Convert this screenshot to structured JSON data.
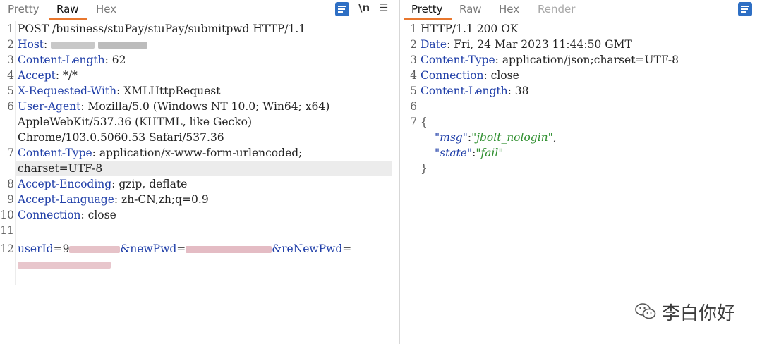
{
  "request": {
    "tabs": [
      {
        "label": "Pretty",
        "state": "normal"
      },
      {
        "label": "Raw",
        "state": "active"
      },
      {
        "label": "Hex",
        "state": "normal"
      }
    ],
    "newline_label": "\\n",
    "menu_icon": "hamburger-icon",
    "wrap_icon": "word-wrap-icon",
    "lines": {
      "l1": "POST /business/stuPay/stuPay/submitpwd HTTP/1.1",
      "l2k": "Host",
      "l3k": "Content-Length",
      "l3v": ": 62",
      "l4k": "Accept",
      "l4v": ": */*",
      "l5k": "X-Requested-With",
      "l5v": ": XMLHttpRequest",
      "l6k": "User-Agent",
      "l6v": ": Mozilla/5.0 (Windows NT 10.0; Win64; x64)",
      "l6b": "AppleWebKit/537.36 (KHTML, like Gecko)",
      "l6c": "Chrome/103.0.5060.53 Safari/537.36",
      "l7k": "Content-Type",
      "l7v": ": application/x-www-form-urlencoded;",
      "l7b": "charset=UTF-8",
      "l8k": "Accept-Encoding",
      "l8v": ": gzip, deflate",
      "l9k": "Accept-Language",
      "l9v": ": zh-CN,zh;q=0.9",
      "l10k": "Connection",
      "l10v": ": close",
      "l12a": "userId",
      "l12b": "=9",
      "l12c": "&newPwd",
      "l12d": "=",
      "l12e": "&reNewPwd",
      "l12f": "="
    }
  },
  "response": {
    "tabs": [
      {
        "label": "Pretty",
        "state": "active"
      },
      {
        "label": "Raw",
        "state": "normal"
      },
      {
        "label": "Hex",
        "state": "normal"
      },
      {
        "label": "Render",
        "state": "disabled"
      }
    ],
    "wrap_icon": "word-wrap-icon",
    "lines": {
      "l1": "HTTP/1.1 200 OK",
      "l2k": "Date",
      "l2v": ": Fri, 24 Mar 2023 11:44:50 GMT",
      "l3k": "Content-Type",
      "l3v": ": application/json;charset=UTF-8",
      "l4k": "Connection",
      "l4v": ": close",
      "l5k": "Content-Length",
      "l5v": ": 38",
      "l7": "{",
      "j1k": "\"msg\"",
      "j1s": ":",
      "j1v": "\"jbolt_nologin\"",
      "j1c": ",",
      "j2k": "\"state\"",
      "j2s": ":",
      "j2v": "\"fail\"",
      "close": "}"
    }
  },
  "watermark": {
    "text": "李白你好",
    "icon": "wechat-icon"
  },
  "colors": {
    "accent": "#e8772e",
    "key": "#1f3ea8",
    "string": "#2f8f2f",
    "wrap_button": "#2e6fc4"
  }
}
